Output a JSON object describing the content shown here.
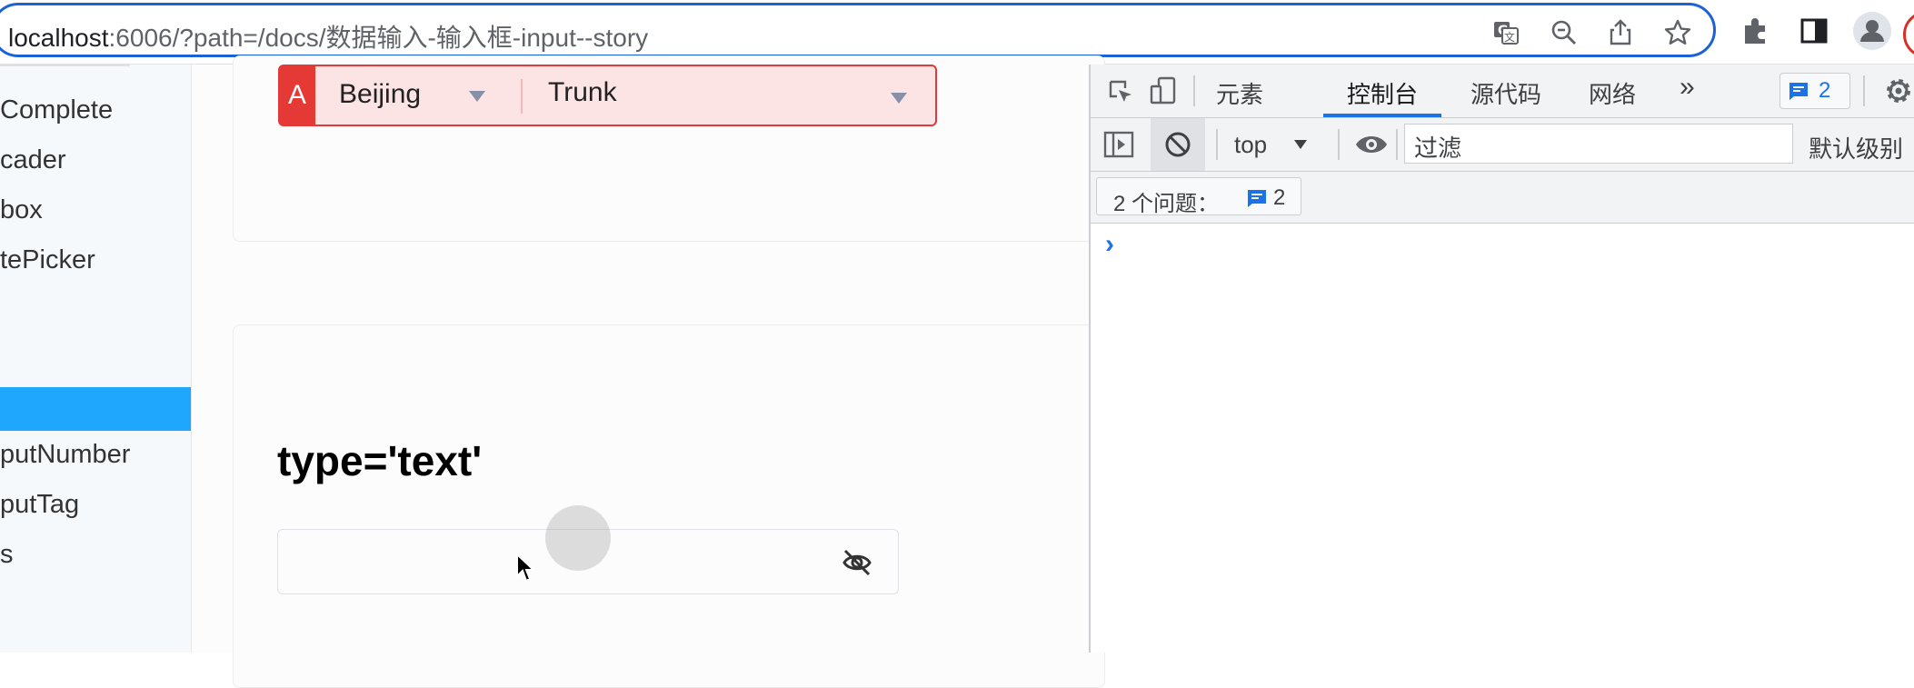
{
  "browser": {
    "url_host": "localhost",
    "url_rest": ":6006/?path=/docs/数据输入-输入框-input--story",
    "icons": [
      "translate-icon",
      "zoom-icon",
      "share-icon",
      "star-icon",
      "extensions-icon",
      "side-panel-icon",
      "profile-icon"
    ]
  },
  "sidebar": {
    "items": [
      {
        "label": "Complete",
        "active": false
      },
      {
        "label": "cader",
        "active": false
      },
      {
        "label": "box",
        "active": false
      },
      {
        "label": "tePicker",
        "active": false
      },
      {
        "label": "",
        "active": true
      },
      {
        "label": "putNumber",
        "active": false
      },
      {
        "label": "putTag",
        "active": false
      },
      {
        "label": "s",
        "active": false
      }
    ]
  },
  "main": {
    "cascader": {
      "prefix": "A",
      "city": "Beijing",
      "line": "Trunk"
    },
    "story_title": "type='text'",
    "password_input": {
      "value": "",
      "visibility_icon": "eye-off-icon"
    }
  },
  "devtools": {
    "tabs": [
      "元素",
      "控制台",
      "源代码",
      "网络"
    ],
    "active_tab": "控制台",
    "more_tabs": "»",
    "issues_badge_count": "2",
    "context_select": "top",
    "filter_placeholder": "过滤",
    "level_select": "默认级别",
    "issues_label": "2 个问题：",
    "issues_count": "2",
    "prompt": "›",
    "accent_color": "#1a73e8"
  }
}
